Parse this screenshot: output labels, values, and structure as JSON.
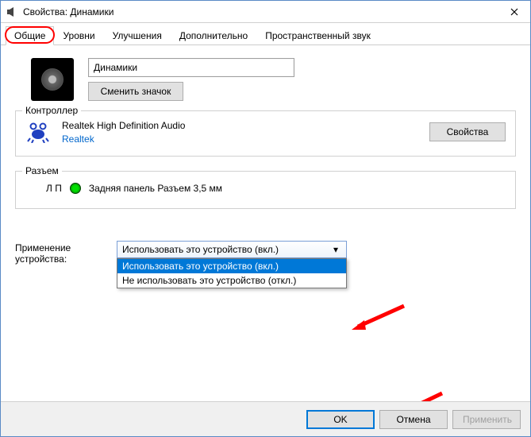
{
  "window": {
    "title": "Свойства: Динамики"
  },
  "tabs": {
    "general": "Общие",
    "levels": "Уровни",
    "enhancements": "Улучшения",
    "advanced": "Дополнительно",
    "spatial": "Пространственный звук"
  },
  "device": {
    "name_value": "Динамики",
    "change_icon_label": "Сменить значок"
  },
  "controller": {
    "group_title": "Контроллер",
    "name": "Realtek High Definition Audio",
    "vendor": "Realtek",
    "properties_label": "Свойства"
  },
  "jack": {
    "group_title": "Разъем",
    "channel": "Л П",
    "description": "Задняя панель Разъем 3,5 мм"
  },
  "usage": {
    "label": "Применение устройства:",
    "selected": "Использовать это устройство (вкл.)",
    "options": [
      "Использовать это устройство (вкл.)",
      "Не использовать это устройство (откл.)"
    ]
  },
  "footer": {
    "ok": "OK",
    "cancel": "Отмена",
    "apply": "Применить"
  }
}
